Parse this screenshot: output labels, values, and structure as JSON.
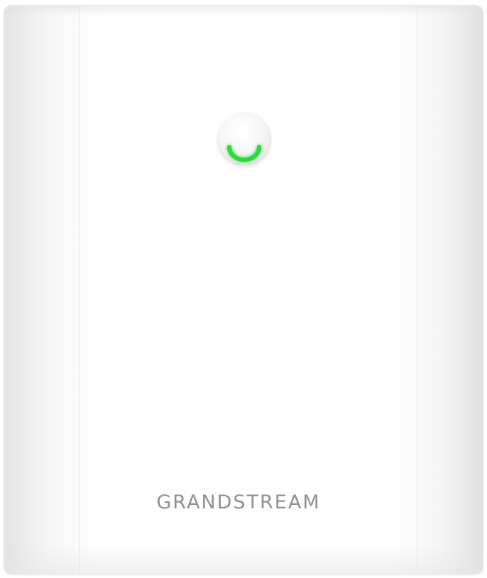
{
  "device": {
    "brand": "GRANDSTREAM",
    "body_color": "#fefefe",
    "led": {
      "icon": "status-led-icon",
      "color": "#2bd93a",
      "state": "on"
    },
    "logo_color": "#8f9094"
  }
}
